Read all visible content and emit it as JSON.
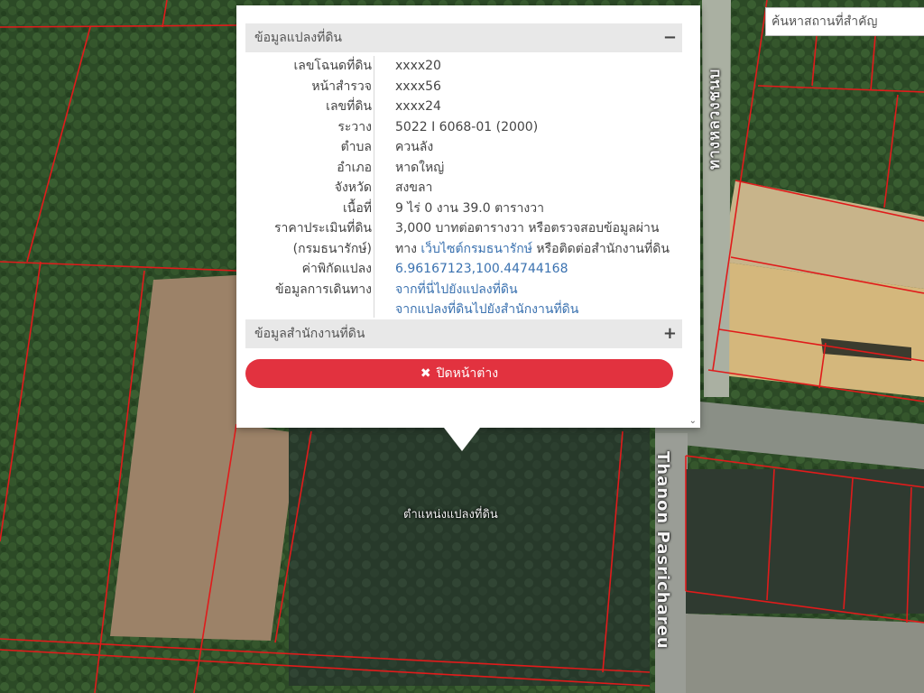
{
  "map": {
    "road_label_vertical": "Thanon Pasrichareu",
    "road_label_thai": "ทางหลวงชนบ",
    "parcel_label": "ตำแหน่งแปลงที่ดิน"
  },
  "search": {
    "placeholder": "ค้นหาสถานที่สำคัญ"
  },
  "popup": {
    "section1_title": "ข้อมูลแปลงที่ดิน",
    "section1_toggle": "−",
    "section2_title": "ข้อมูลสำนักงานที่ดิน",
    "section2_toggle": "+",
    "close_icon": "✖",
    "close_label": "ปิดหน้าต่าง",
    "scroll_icon": "⌄",
    "rows": [
      {
        "key": "เลขโฉนดที่ดิน",
        "value": "xxxx20"
      },
      {
        "key": "หน้าสำรวจ",
        "value": "xxxx56"
      },
      {
        "key": "เลขที่ดิน",
        "value": "xxxx24"
      },
      {
        "key": "ระวาง",
        "value": "5022 I 6068-01 (2000)"
      },
      {
        "key": "ตำบล",
        "value": "ควนลัง"
      },
      {
        "key": "อำเภอ",
        "value": "หาดใหญ่"
      },
      {
        "key": "จังหวัด",
        "value": "สงขลา"
      },
      {
        "key": "เนื้อที่",
        "value": "9 ไร่ 0 งาน 39.0 ตารางวา"
      },
      {
        "key": "ราคาประเมินที่ดิน",
        "value": "3,000 บาทต่อตารางวา หรือตรวจสอบข้อมูลผ่าน"
      },
      {
        "key": "(กรมธนารักษ์)",
        "value_pre": "ทาง ",
        "value_link": "เว็บไซต์กรมธนารักษ์",
        "value_post": " หรือติดต่อสำนักงานที่ดิน"
      },
      {
        "key": "ค่าพิกัดแปลง",
        "value": "6.96167123,100.44744168"
      },
      {
        "key": "ข้อมูลการเดินทาง",
        "value": "จากที่นี่ไปยังแปลงที่ดิน"
      },
      {
        "key": "",
        "value": "จากแปลงที่ดินไปยังสำนักงานที่ดิน"
      }
    ]
  }
}
